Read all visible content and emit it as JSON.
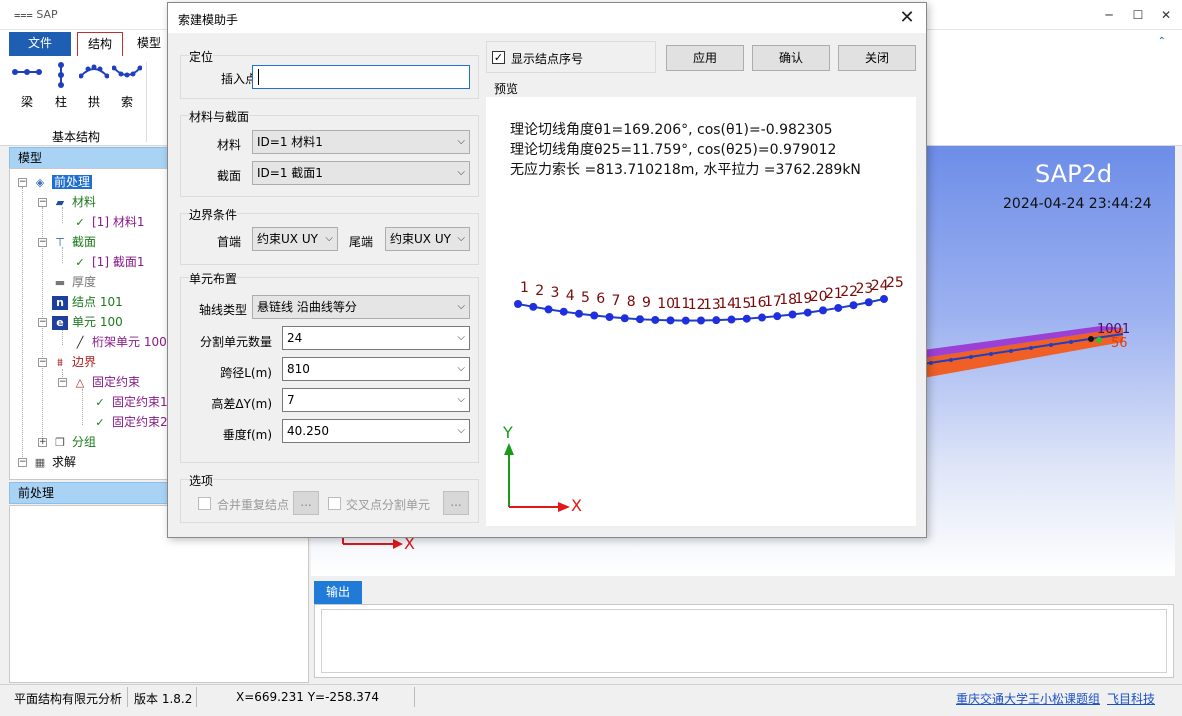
{
  "app": {
    "title": "SAP"
  },
  "window_controls": {
    "minimize": "─",
    "maximize": "☐",
    "close": "✕"
  },
  "ribbon": {
    "tabs": [
      {
        "label": "文件"
      },
      {
        "label": "结构"
      },
      {
        "label": "模型"
      }
    ],
    "collapse_icon": "⌃",
    "items": [
      {
        "label": "梁"
      },
      {
        "label": "柱"
      },
      {
        "label": "拱"
      },
      {
        "label": "索"
      }
    ],
    "group_label": "基本结构"
  },
  "model_panel": {
    "title": "模型",
    "tree": {
      "preprocess": "前处理",
      "material": "材料",
      "material_item": "[1] 材料1",
      "section": "截面",
      "section_item": "[1] 截面1",
      "thickness": "厚度",
      "nodes": "结点 101",
      "elements": "单元 100",
      "truss": "桁架单元 100",
      "boundary": "边界",
      "fixed": "固定约束",
      "fixed1": "固定约束1",
      "fixed2": "固定约束2",
      "group": "分组",
      "solve": "求解"
    }
  },
  "preprocess_panel": {
    "title": "前处理"
  },
  "canvas": {
    "app_name": "SAP2d",
    "datetime": "2024-04-24 23:44:24",
    "axis_x": "X",
    "node_label_right": "1001",
    "node_label_orange": "56"
  },
  "output": {
    "tab_label": "输出"
  },
  "statusbar": {
    "app_desc": "平面结构有限元分析",
    "version": "版本 1.8.2",
    "coords": "X=669.231  Y=-258.374",
    "credit": "重庆交通大学王小松课题组",
    "link": "飞目科技"
  },
  "dialog": {
    "title": "索建模助手",
    "close": "✕",
    "positioning": {
      "title": "定位",
      "insert_label": "插入点",
      "insert_value": ""
    },
    "material_section": {
      "title": "材料与截面",
      "material_label": "材料",
      "material_value": "ID=1  材料1",
      "section_label": "截面",
      "section_value": "ID=1  截面1"
    },
    "boundary": {
      "title": "边界条件",
      "head_label": "首端",
      "head_value": "约束UX UY",
      "tail_label": "尾端",
      "tail_value": "约束UX UY"
    },
    "elements": {
      "title": "单元布置",
      "axis_type_label": "轴线类型",
      "axis_type_value": "悬链线 沿曲线等分",
      "count_label": "分割单元数量",
      "count_value": "24",
      "span_label": "跨径L(m)",
      "span_value": "810",
      "height_label": "高差ΔY(m)",
      "height_value": "7",
      "sag_label": "垂度f(m)",
      "sag_value": "40.250"
    },
    "options": {
      "title": "选项",
      "merge_label": "合并重复结点",
      "split_label": "交叉点分割单元",
      "more": "..."
    },
    "show_node_numbers": {
      "label": "显示结点序号",
      "checked": true
    },
    "buttons": {
      "apply": "应用",
      "confirm": "确认",
      "close": "关闭"
    },
    "preview": {
      "title": "预览",
      "line1": "理论切线角度θ1=169.206°, cos(θ1)=-0.982305",
      "line2": "理论切线角度θ25=11.759°, cos(θ25)=0.979012",
      "line3": "无应力索长 =813.710218m, 水平拉力 =3762.289kN",
      "axis_y": "Y",
      "axis_x": "X",
      "node_labels": [
        "1",
        "2",
        "3",
        "4",
        "5",
        "6",
        "7",
        "8",
        "9",
        "10",
        "11",
        "12",
        "13",
        "14",
        "15",
        "16",
        "17",
        "18",
        "19",
        "20",
        "21",
        "22",
        "23",
        "24",
        "25"
      ]
    }
  }
}
